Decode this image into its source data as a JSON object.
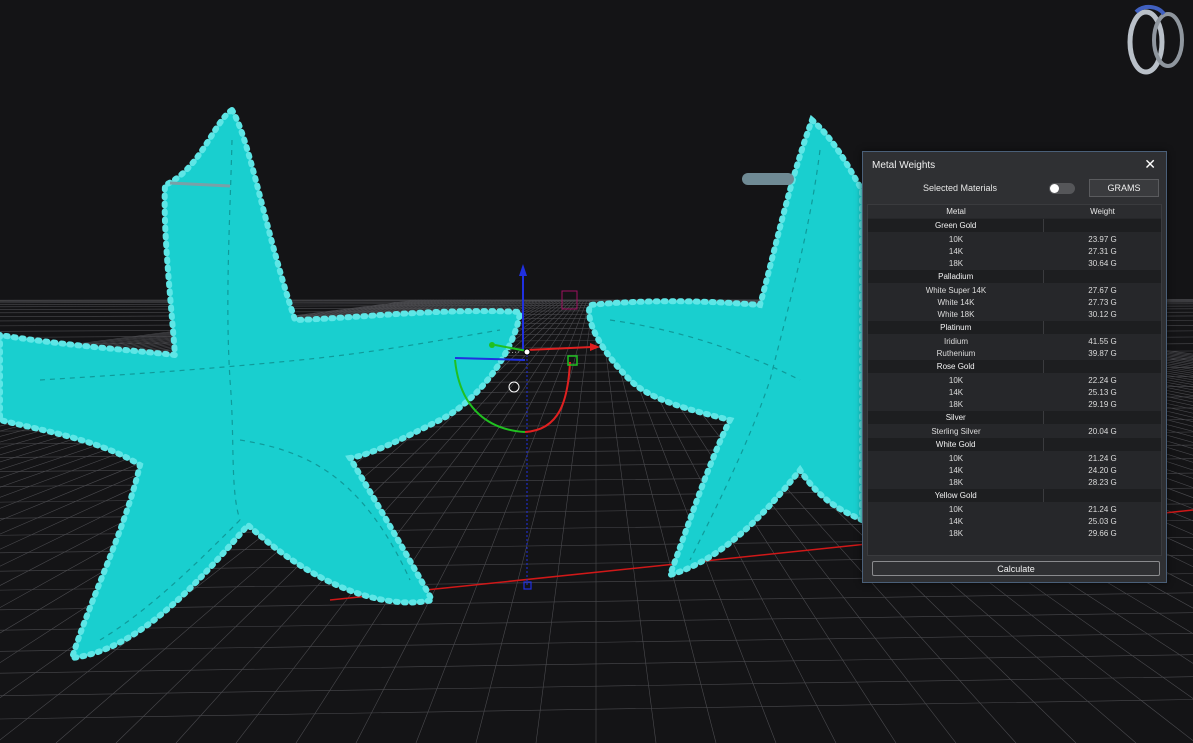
{
  "panel": {
    "title": "Metal Weights",
    "close_glyph": "✕",
    "selected_materials_label": "Selected Materials",
    "selected_materials_on": false,
    "unit_button": "GRAMS",
    "columns": {
      "metal": "Metal",
      "weight": "Weight"
    },
    "groups": [
      {
        "name": "Green Gold",
        "items": [
          {
            "metal": "10K",
            "weight": "23.97 G"
          },
          {
            "metal": "14K",
            "weight": "27.31 G"
          },
          {
            "metal": "18K",
            "weight": "30.64 G"
          }
        ]
      },
      {
        "name": "Palladium",
        "items": [
          {
            "metal": "White Super 14K",
            "weight": "27.67 G"
          },
          {
            "metal": "White 14K",
            "weight": "27.73 G"
          },
          {
            "metal": "White 18K",
            "weight": "30.12 G"
          }
        ]
      },
      {
        "name": "Platinum",
        "items": [
          {
            "metal": "Iridium",
            "weight": "41.55 G"
          },
          {
            "metal": "Ruthenium",
            "weight": "39.87 G"
          }
        ]
      },
      {
        "name": "Rose Gold",
        "items": [
          {
            "metal": "10K",
            "weight": "22.24 G"
          },
          {
            "metal": "14K",
            "weight": "25.13 G"
          },
          {
            "metal": "18K",
            "weight": "29.19 G"
          }
        ]
      },
      {
        "name": "Silver",
        "items": [
          {
            "metal": "Sterling Silver",
            "weight": "20.04 G"
          }
        ]
      },
      {
        "name": "White Gold",
        "items": [
          {
            "metal": "10K",
            "weight": "21.24 G"
          },
          {
            "metal": "14K",
            "weight": "24.20 G"
          },
          {
            "metal": "18K",
            "weight": "28.23 G"
          }
        ]
      },
      {
        "name": "Yellow Gold",
        "items": [
          {
            "metal": "10K",
            "weight": "21.24 G"
          },
          {
            "metal": "14K",
            "weight": "25.03 G"
          },
          {
            "metal": "18K",
            "weight": "29.66 G"
          }
        ]
      }
    ],
    "calculate_button": "Calculate"
  },
  "viewport": {
    "background": "#141416",
    "model_color": "#19cfcf",
    "bead_color": "#5ee6e6",
    "grid_color": "#4a4a4e",
    "axis_x_color": "#e02020",
    "axis_y_color": "#20c020",
    "axis_z_color": "#2030e0"
  },
  "icons": {
    "view_cube": "ring-icon",
    "close": "close-icon"
  }
}
